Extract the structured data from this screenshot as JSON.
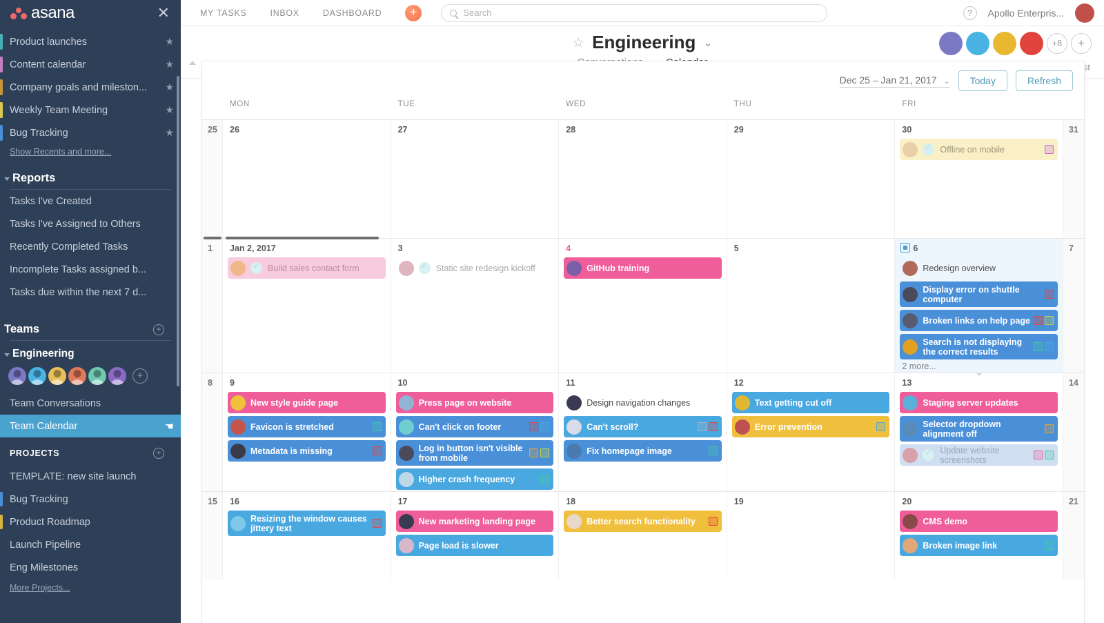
{
  "sidebar": {
    "brand": "asana",
    "close_label": "✕",
    "favorites": [
      {
        "label": "Product launches",
        "color": "#45b0b8"
      },
      {
        "label": "Content calendar",
        "color": "#c77fc4"
      },
      {
        "label": "Company goals and mileston...",
        "color": "#c79438"
      },
      {
        "label": "Weekly Team Meeting",
        "color": "#d6c94e"
      },
      {
        "label": "Bug Tracking",
        "color": "#4a90d9"
      }
    ],
    "show_recents": "Show Recents and more...",
    "reports_title": "Reports",
    "reports": [
      "Tasks I've Created",
      "Tasks I've Assigned to Others",
      "Recently Completed Tasks",
      "Incomplete Tasks assigned b...",
      "Tasks due within the next 7 d..."
    ],
    "teams_title": "Teams",
    "team_name": "Engineering",
    "team_links": [
      {
        "label": "Team Conversations",
        "active": false
      },
      {
        "label": "Team Calendar",
        "active": true
      }
    ],
    "projects_title": "PROJECTS",
    "projects": [
      {
        "label": "TEMPLATE: new site launch",
        "color": ""
      },
      {
        "label": "Bug Tracking",
        "color": "#4a90d9"
      },
      {
        "label": "Product Roadmap",
        "color": "#d6b33d"
      },
      {
        "label": "Launch Pipeline",
        "color": ""
      },
      {
        "label": "Eng Milestones",
        "color": ""
      }
    ],
    "more_projects": "More Projects...",
    "add_label": "+"
  },
  "topbar": {
    "nav": [
      "MY TASKS",
      "INBOX",
      "DASHBOARD"
    ],
    "add_label": "+",
    "search_placeholder": "Search",
    "help_label": "?",
    "org_name": "Apollo Enterpris..."
  },
  "project_header": {
    "title": "Engineering",
    "star": "☆",
    "chevron": "⌄",
    "tabs": [
      {
        "label": "Conversations",
        "active": false
      },
      {
        "label": "Calendar",
        "active": true
      }
    ],
    "members_more": "+8",
    "members_add": "+",
    "membership_note": "Membership by Request"
  },
  "calendar": {
    "range_label": "Dec 25 – Jan 21, 2017",
    "range_chevron": "⌄",
    "today_button": "Today",
    "refresh_button": "Refresh",
    "day_headers": [
      "MON",
      "TUE",
      "WED",
      "THU",
      "FRI"
    ],
    "more_link": "2 more...",
    "weeks": [
      {
        "edge_left": "25",
        "edge_right": "31",
        "days": [
          {
            "num": "26",
            "tasks": []
          },
          {
            "num": "27",
            "tasks": []
          },
          {
            "num": "28",
            "tasks": []
          },
          {
            "num": "29",
            "tasks": []
          },
          {
            "num": "30",
            "tasks": [
              {
                "title": "Offline on mobile",
                "style": "ghost-yellow",
                "check": true,
                "avatar": "#e8cfa8",
                "tags": [
                  "#c86ed8"
                ]
              }
            ]
          }
        ]
      },
      {
        "edge_left": "1",
        "edge_right": "7",
        "days": [
          {
            "num": "Jan 2, 2017",
            "first": true,
            "tasks": [
              {
                "title": "Build sales contact form",
                "style": "ghost-pink",
                "check": true,
                "avatar": "#f0b888",
                "tags": []
              }
            ]
          },
          {
            "num": "3",
            "tasks": [
              {
                "title": "Static site redesign kickoff",
                "style": "ghost-plain",
                "check": true,
                "avatar": "#e0b4c0",
                "tags": []
              }
            ]
          },
          {
            "num": "4",
            "red": true,
            "tasks": [
              {
                "title": "GitHub training",
                "style": "pink",
                "avatar": "#7b5ea8",
                "tags": []
              }
            ]
          },
          {
            "num": "5",
            "tasks": []
          },
          {
            "num": "6",
            "today": true,
            "highlight": true,
            "tasks": [
              {
                "title": "Redesign overview",
                "style": "plain",
                "avatar": "#b06a5c",
                "tags": []
              },
              {
                "title": "Display error on shuttle computer",
                "style": "blue",
                "tall": true,
                "avatar": "#4a4a5a",
                "tags": [
                  "#e8453c"
                ]
              },
              {
                "title": "Broken links on help page",
                "style": "blue",
                "avatar": "#5a5a70",
                "tags": [
                  "#e8453c",
                  "#c9d43a"
                ]
              },
              {
                "title": "Search is not displaying the correct results",
                "style": "blue",
                "tall": true,
                "avatar": "#e0a020",
                "tags": [
                  "#3ec9a7",
                  "#4aa8e0"
                ]
              }
            ]
          }
        ]
      },
      {
        "edge_left": "8",
        "edge_right": "14",
        "days": [
          {
            "num": "9",
            "tasks": [
              {
                "title": "New style guide page",
                "style": "pink",
                "avatar": "#f0c23a",
                "tags": []
              },
              {
                "title": "Favicon is stretched",
                "style": "blue",
                "avatar": "#c4554a",
                "tags": [
                  "#3ec9a7"
                ]
              },
              {
                "title": "Metadata is missing",
                "style": "blue",
                "avatar": "#3a3a48",
                "tags": [
                  "#e8453c"
                ]
              }
            ]
          },
          {
            "num": "10",
            "tasks": [
              {
                "title": "Press page on website",
                "style": "pink",
                "avatar": "#8fb4d4",
                "tags": []
              },
              {
                "title": "Can't click on footer",
                "style": "blue",
                "avatar": "#6fcfcf",
                "tags": [
                  "#e8453c",
                  "#4aa8e0"
                ]
              },
              {
                "title": "Log in button isn't visible from mobile",
                "style": "blue",
                "tall": true,
                "avatar": "#4a4a5a",
                "tags": [
                  "#f0a020",
                  "#c9d43a"
                ]
              },
              {
                "title": "Higher crash frequency",
                "style": "lightblue",
                "avatar": "#bfd8e8",
                "tags": [
                  "#3ec9a7"
                ]
              }
            ]
          },
          {
            "num": "11",
            "tasks": [
              {
                "title": "Design navigation changes",
                "style": "plain",
                "avatar": "#3a3a52",
                "tags": []
              },
              {
                "title": "Can't scroll?",
                "style": "lightblue",
                "avatar": "#d8dce8",
                "tags": [
                  "#a8b4c4",
                  "#e8453c"
                ]
              },
              {
                "title": "Fix homepage image",
                "style": "blue",
                "avatar": "#4a7ab0",
                "tags": [
                  "#3ec9a7"
                ]
              }
            ]
          },
          {
            "num": "12",
            "tasks": [
              {
                "title": "Text getting cut off",
                "style": "lightblue",
                "avatar": "#e0b830",
                "tags": []
              },
              {
                "title": "Error prevention",
                "style": "yellow",
                "avatar": "#c05050",
                "tags": [
                  "#4aa8e0"
                ]
              }
            ]
          },
          {
            "num": "13",
            "tasks": [
              {
                "title": "Staging server updates",
                "style": "pink",
                "avatar": "#5ab0d8",
                "tags": []
              },
              {
                "title": "Selector dropdown alignment off",
                "style": "blue",
                "tall": true,
                "avatar": "#5a8ab8",
                "tags": [
                  "#f0a020"
                ]
              },
              {
                "title": "Update website screenshots",
                "style": "ghost-blue",
                "check": true,
                "avatar": "#d8a0a8",
                "tags": [
                  "#ef5e9a",
                  "#3ec9a7"
                ]
              }
            ]
          }
        ]
      },
      {
        "edge_left": "15",
        "edge_right": "21",
        "days": [
          {
            "num": "16",
            "tasks": [
              {
                "title": "Resizing the window causes jittery text",
                "style": "lightblue",
                "tall": true,
                "avatar": "#7fc8e8",
                "tags": [
                  "#e8453c"
                ]
              }
            ]
          },
          {
            "num": "17",
            "tasks": [
              {
                "title": "New marketing landing page",
                "style": "pink",
                "avatar": "#3a3a52",
                "tags": []
              },
              {
                "title": "Page load is slower",
                "style": "lightblue",
                "avatar": "#d8b8c8",
                "tags": []
              }
            ]
          },
          {
            "num": "18",
            "tasks": [
              {
                "title": "Better search functionality",
                "style": "yellow",
                "avatar": "#e8d8c8",
                "tags": [
                  "#e8453c"
                ]
              }
            ]
          },
          {
            "num": "19",
            "tasks": []
          },
          {
            "num": "20",
            "tasks": [
              {
                "title": "CMS demo",
                "style": "pink",
                "avatar": "#8a4a4a",
                "tags": []
              },
              {
                "title": "Broken image link",
                "style": "lightblue",
                "avatar": "#e0a878",
                "tags": [
                  "#3ec9a7"
                ]
              }
            ]
          }
        ]
      }
    ]
  }
}
